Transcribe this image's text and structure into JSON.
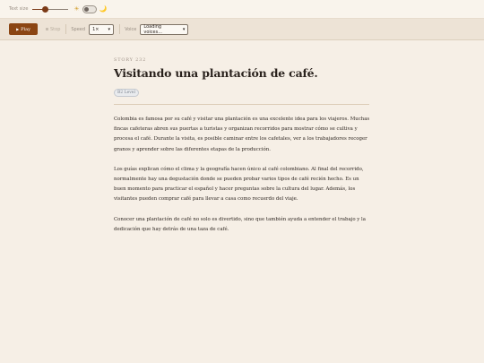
{
  "settings": {
    "text_size_label": "Text size",
    "text_size_value": 0.35,
    "sun_icon": "☀",
    "moon_icon": "🌙",
    "dark_mode": false
  },
  "toolbar": {
    "play_label": "Play",
    "play_icon": "▶",
    "stop_label": "Stop",
    "speed_label": "Speed",
    "speed_value": "1×",
    "voice_label": "Voice",
    "voice_value": "Loading voices..."
  },
  "story": {
    "number": "STORY 232",
    "title": "Visitando una plantación de café.",
    "level": "B2 Level",
    "paragraphs": [
      "Colombia es famosa por su café y visitar una plantación es una excelente idea para los viajeros. Muchas fincas cafeteras abren sus puertas a turistas y organizan recorridos para mostrar cómo se cultiva y procesa el café. Durante la visita, es posible caminar entre los cafetales, ver a los trabajadores recoger granos y aprender sobre las diferentes etapas de la producción.",
      "Los guías explican cómo el clima y la geografía hacen único al café colombiano. Al final del recorrido, normalmente hay una degustación donde se pueden probar varios tipos de café recién hecho. Es un buen momento para practicar el español y hacer preguntas sobre la cultura del lugar. Además, los visitantes pueden comprar café para llevar a casa como recuerdo del viaje.",
      "Conocer una plantación de café no solo es divertido, sino que también ayuda a entender el trabajo y la dedicación que hay detrás de una taza de café."
    ]
  },
  "colors": {
    "accent": "#8b4513",
    "background": "#f6efe6",
    "toolbar_bg": "#ede3d6"
  }
}
